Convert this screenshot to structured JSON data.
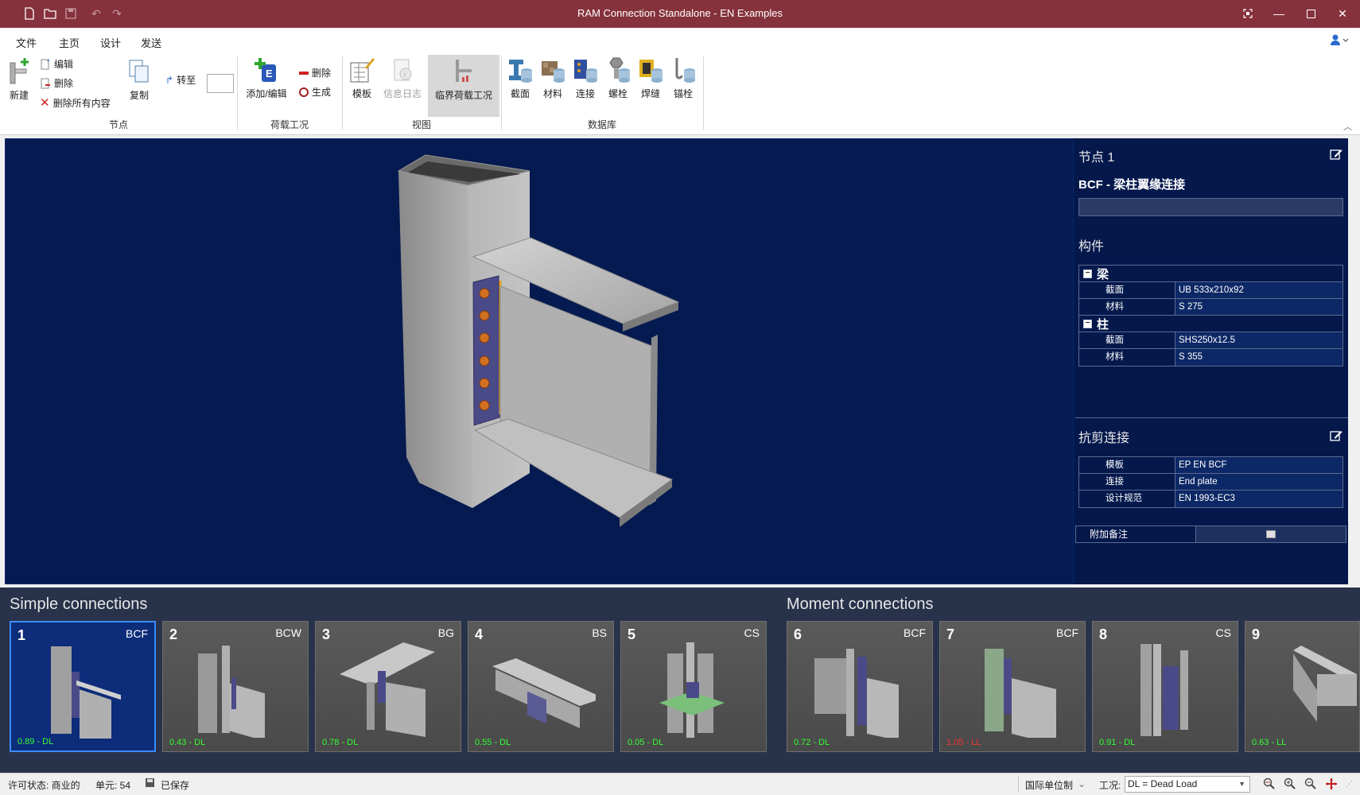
{
  "window": {
    "title": "RAM Connection Standalone - EN Examples"
  },
  "menu": {
    "tabs": [
      "文件",
      "主页",
      "设计",
      "发送"
    ],
    "active": "主页"
  },
  "ribbon": {
    "node": {
      "new_label": "新建",
      "edit_label": "编辑",
      "delete_label": "删除",
      "delete_all_label": "删除所有内容",
      "copy_label": "复制",
      "goto_label": "转至",
      "group_label": "节点"
    },
    "loads": {
      "add_edit_label": "添加/编辑",
      "delete_label": "删除",
      "generate_label": "生成",
      "group_label": "荷载工况"
    },
    "view": {
      "template_label": "模板",
      "info_log_label": "信息日志",
      "critical_load_label": "临界荷载工况",
      "group_label": "视图"
    },
    "database": {
      "section_label": "截面",
      "material_label": "材料",
      "connection_label": "连接",
      "bolt_label": "螺栓",
      "weld_label": "焊缝",
      "anchor_label": "锚栓",
      "group_label": "数据库"
    }
  },
  "properties": {
    "node_title": "节点 1",
    "connection_type": "BCF - 梁柱翼缘连接",
    "members_title": "构件",
    "beam": {
      "label": "梁",
      "section_key": "截面",
      "section_value": "UB 533x210x92",
      "material_key": "材料",
      "material_value": "S 275"
    },
    "column": {
      "label": "柱",
      "section_key": "截面",
      "section_value": "SHS250x12.5",
      "material_key": "材料",
      "material_value": "S 355"
    },
    "shear_title": "抗剪连接",
    "shear": {
      "template_key": "模板",
      "template_value": "EP EN BCF",
      "connection_key": "连接",
      "connection_value": "End plate",
      "code_key": "设计规范",
      "code_value": "EN 1993-EC3"
    },
    "notes_label": "附加备注"
  },
  "gallery": {
    "simple_title": "Simple connections",
    "moment_title": "Moment connections",
    "cards": [
      {
        "num": "1",
        "type": "BCF",
        "ratio": "0.89 - DL",
        "status": "ok"
      },
      {
        "num": "2",
        "type": "BCW",
        "ratio": "0.43 - DL",
        "status": "ok"
      },
      {
        "num": "3",
        "type": "BG",
        "ratio": "0.78 - DL",
        "status": "ok"
      },
      {
        "num": "4",
        "type": "BS",
        "ratio": "0.55 - DL",
        "status": "ok"
      },
      {
        "num": "5",
        "type": "CS",
        "ratio": "0.05 - DL",
        "status": "ok"
      },
      {
        "num": "6",
        "type": "BCF",
        "ratio": "0.72 - DL",
        "status": "ok"
      },
      {
        "num": "7",
        "type": "BCF",
        "ratio": "1.05 - LL",
        "status": "fail"
      },
      {
        "num": "8",
        "type": "CS",
        "ratio": "0.91 - DL",
        "status": "ok"
      },
      {
        "num": "9",
        "type": "",
        "ratio": "0.63 - LL",
        "status": "ok"
      }
    ]
  },
  "status": {
    "license": "许可状态: 商业的",
    "units_count": "单元: 54",
    "saved": "已保存",
    "unit_system": "国际单位制",
    "load_case_label": "工况:",
    "load_case_value": "DL = Dead Load"
  },
  "colors": {
    "titlebar": "#86323c",
    "viewport": "#051a50",
    "ratio_ok": "#32ff32",
    "ratio_fail": "#ff3030"
  }
}
